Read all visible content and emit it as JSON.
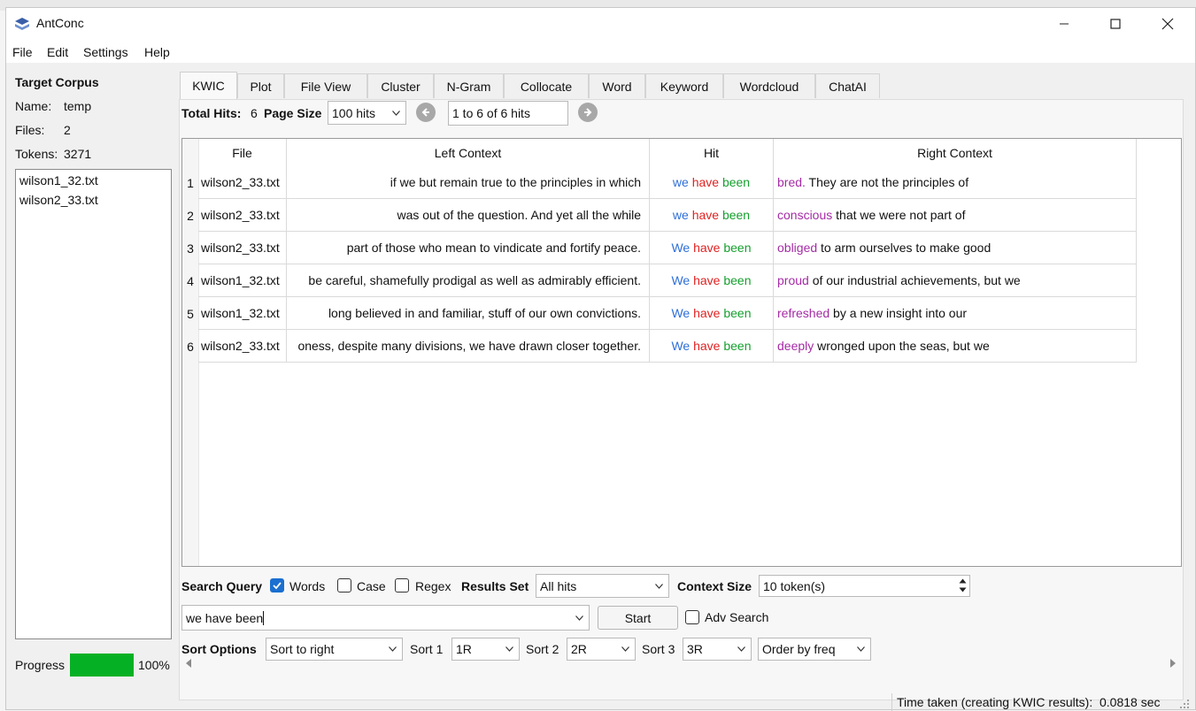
{
  "window": {
    "title": "AntConc"
  },
  "menu": [
    "File",
    "Edit",
    "Settings",
    "Help"
  ],
  "left_panel": {
    "heading": "Target Corpus",
    "name_label": "Name:",
    "name_value": "temp",
    "files_label": "Files:",
    "files_value": "2",
    "tokens_label": "Tokens:",
    "tokens_value": "3271",
    "files": [
      "wilson1_32.txt",
      "wilson2_33.txt"
    ],
    "progress_label": "Progress",
    "progress_value": "100%",
    "progress_fraction": 1.0,
    "progress_color": "#06b025"
  },
  "tabs": [
    "KWIC",
    "Plot",
    "File View",
    "Cluster",
    "N-Gram",
    "Collocate",
    "Word",
    "Keyword",
    "Wordcloud",
    "ChatAI"
  ],
  "active_tab": "KWIC",
  "toolbar": {
    "total_hits_label": "Total Hits:",
    "total_hits_value": "6",
    "page_size_label": "Page Size",
    "page_size_value": "100 hits",
    "page_range": "1 to 6 of 6 hits"
  },
  "table": {
    "columns": [
      "File",
      "Left Context",
      "Hit",
      "Right Context"
    ],
    "rows": [
      {
        "n": "1",
        "file": "wilson2_33.txt",
        "left": "if we but remain true to the principles in which",
        "hit": [
          "we",
          "have",
          "been"
        ],
        "right_word": "bred.",
        "right_rest": " They are not the principles of"
      },
      {
        "n": "2",
        "file": "wilson2_33.txt",
        "left": "was out of the question. And yet all the while",
        "hit": [
          "we",
          "have",
          "been"
        ],
        "right_word": "conscious",
        "right_rest": " that we were not part of"
      },
      {
        "n": "3",
        "file": "wilson2_33.txt",
        "left": "part of those who mean to vindicate and fortify peace.",
        "hit": [
          "We",
          "have",
          "been"
        ],
        "right_word": "obliged",
        "right_rest": " to arm ourselves to make good"
      },
      {
        "n": "4",
        "file": "wilson1_32.txt",
        "left": "be careful, shamefully prodigal as well as admirably efficient.",
        "hit": [
          "We",
          "have",
          "been"
        ],
        "right_word": "proud",
        "right_rest": " of our industrial achievements, but we"
      },
      {
        "n": "5",
        "file": "wilson1_32.txt",
        "left": "long believed in and familiar, stuff of our own convictions.",
        "hit": [
          "We",
          "have",
          "been"
        ],
        "right_word": "refreshed",
        "right_rest": " by a new insight into our"
      },
      {
        "n": "6",
        "file": "wilson2_33.txt",
        "left": "oness, despite many divisions, we have drawn closer together.",
        "hit": [
          "We",
          "have",
          "been"
        ],
        "right_word": "deeply",
        "right_rest": " wronged upon the seas, but we"
      }
    ],
    "colors": {
      "hit1": "#2f6fd8",
      "hit2": "#e02222",
      "hit3": "#16a02f",
      "right1": "#a52ba5"
    }
  },
  "search": {
    "query_label": "Search Query",
    "words_label": "Words",
    "words_checked": true,
    "case_label": "Case",
    "case_checked": false,
    "regex_label": "Regex",
    "regex_checked": false,
    "results_set_label": "Results Set",
    "results_set_value": "All hits",
    "context_size_label": "Context Size",
    "context_size_value": "10 token(s)",
    "query_value": "we have been",
    "start_label": "Start",
    "adv_search_label": "Adv Search",
    "adv_search_checked": false
  },
  "sort": {
    "options_label": "Sort Options",
    "mode_value": "Sort to right",
    "sort1_label": "Sort 1",
    "sort1_value": "1R",
    "sort2_label": "Sort 2",
    "sort2_value": "2R",
    "sort3_label": "Sort 3",
    "sort3_value": "3R",
    "order_value": "Order by freq"
  },
  "status": {
    "text": "Time taken (creating KWIC results):  0.0818 sec"
  },
  "icons": [
    "app-icon",
    "minimize-icon",
    "maximize-icon",
    "close-icon",
    "prev-page-icon",
    "next-page-icon",
    "chevron-down-icon",
    "spin-up-icon",
    "spin-down-icon",
    "scroll-left-icon",
    "scroll-right-icon",
    "resize-grip-icon"
  ]
}
